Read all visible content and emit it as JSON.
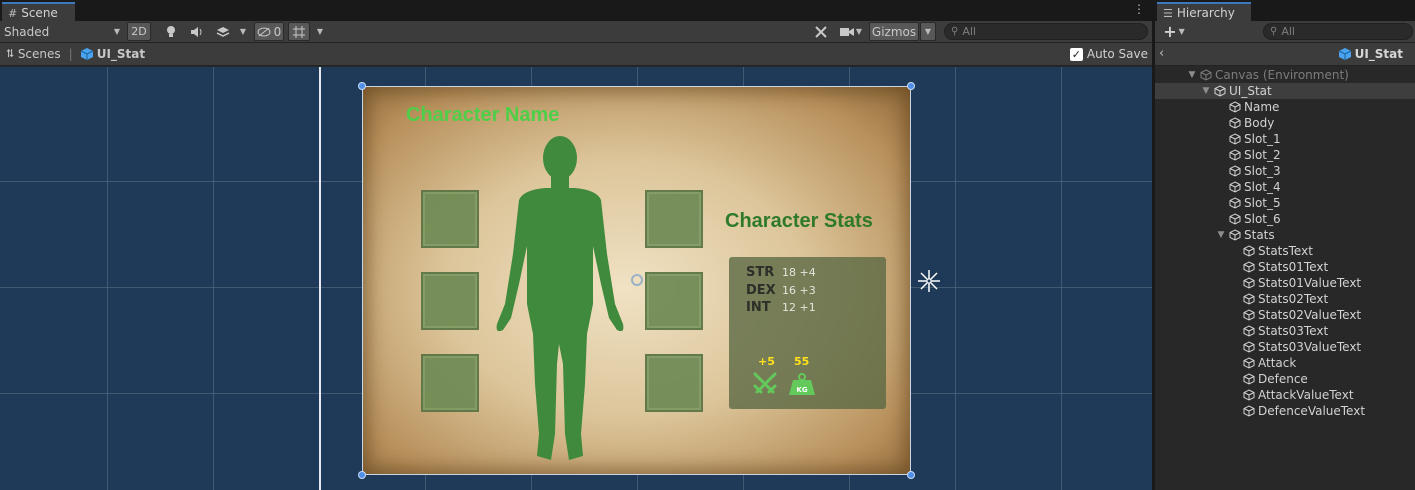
{
  "scene_tab": {
    "label": "Scene"
  },
  "hierarchy_tab": {
    "label": "Hierarchy"
  },
  "toolbar": {
    "shading_mode": "Shaded",
    "mode_2d": "2D",
    "hidden_count": "0",
    "gizmos": "Gizmos",
    "search_placeholder": "All"
  },
  "breadcrumb": {
    "scenes": "Scenes",
    "prefab": "UI_Stat",
    "auto_save": "Auto Save"
  },
  "scene_content": {
    "character_name": "Character Name",
    "stats_title": "Character Stats",
    "stats": [
      {
        "label": "STR",
        "value": "18 +4"
      },
      {
        "label": "DEX",
        "value": "16 +3"
      },
      {
        "label": "INT",
        "value": "12 +1"
      }
    ],
    "attack_bonus": "+5",
    "defence_value": "55",
    "weight_label": "KG"
  },
  "hierarchy": {
    "search_placeholder": "All",
    "prefab_title": "UI_Stat",
    "items": [
      {
        "label": "Canvas (Environment)"
      },
      {
        "label": "UI_Stat"
      },
      {
        "label": "Name"
      },
      {
        "label": "Body"
      },
      {
        "label": "Slot_1"
      },
      {
        "label": "Slot_2"
      },
      {
        "label": "Slot_3"
      },
      {
        "label": "Slot_4"
      },
      {
        "label": "Slot_5"
      },
      {
        "label": "Slot_6"
      },
      {
        "label": "Stats"
      },
      {
        "label": "StatsText"
      },
      {
        "label": "Stats01Text"
      },
      {
        "label": "Stats01ValueText"
      },
      {
        "label": "Stats02Text"
      },
      {
        "label": "Stats02ValueText"
      },
      {
        "label": "Stats03Text"
      },
      {
        "label": "Stats03ValueText"
      },
      {
        "label": "Attack"
      },
      {
        "label": "Defence"
      },
      {
        "label": "AttackValueText"
      },
      {
        "label": "DefenceValueText"
      }
    ]
  },
  "colors": {
    "viewport_bg": "#1f3a58",
    "name_green": "#4fce47",
    "stats_title_green": "#2f7a2a",
    "body_green": "#3f8a3c",
    "bonus_yellow": "#ffe21a",
    "selection_blue": "#4f8fe8"
  },
  "icons": {
    "scene_tab": "grid-hash-icon",
    "hierarchy_tab": "list-icon",
    "prefab": "cube-icon",
    "attack": "crossed-swords-icon",
    "defence": "weight-icon"
  }
}
